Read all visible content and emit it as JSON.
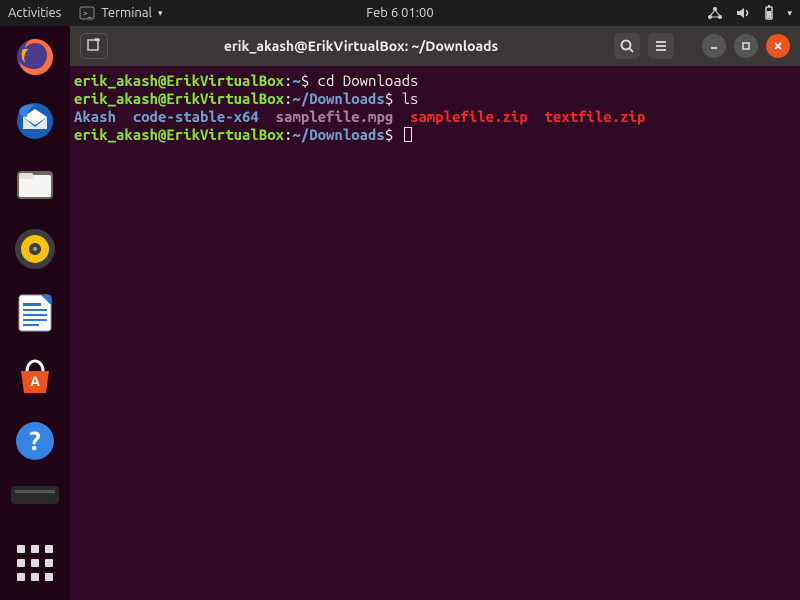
{
  "topbar": {
    "activities": "Activities",
    "app_label": "Terminal",
    "datetime": "Feb 6  01:00"
  },
  "dock": {
    "items": [
      {
        "name": "firefox"
      },
      {
        "name": "thunderbird"
      },
      {
        "name": "files"
      },
      {
        "name": "rhythmbox"
      },
      {
        "name": "libreoffice-writer"
      },
      {
        "name": "ubuntu-software"
      },
      {
        "name": "help"
      }
    ]
  },
  "window": {
    "title": "erik_akash@ErikVirtualBox: ~/Downloads"
  },
  "terminal": {
    "lines": [
      {
        "user": "erik_akash@ErikVirtualBox",
        "sep": ":",
        "path": "~",
        "dollar": "$",
        "cmd": " cd Downloads"
      },
      {
        "user": "erik_akash@ErikVirtualBox",
        "sep": ":",
        "path": "~/Downloads",
        "dollar": "$",
        "cmd": " ls"
      }
    ],
    "ls": {
      "f0": "Akash",
      "s0": "  ",
      "f1": "code-stable-x64",
      "s1": "  ",
      "f2": "samplefile.mpg",
      "s2": "  ",
      "f3": "samplefile.zip",
      "s3": "  ",
      "f4": "textfile.zip"
    },
    "prompt": {
      "user": "erik_akash@ErikVirtualBox",
      "sep": ":",
      "path": "~/Downloads",
      "dollar": "$"
    }
  }
}
